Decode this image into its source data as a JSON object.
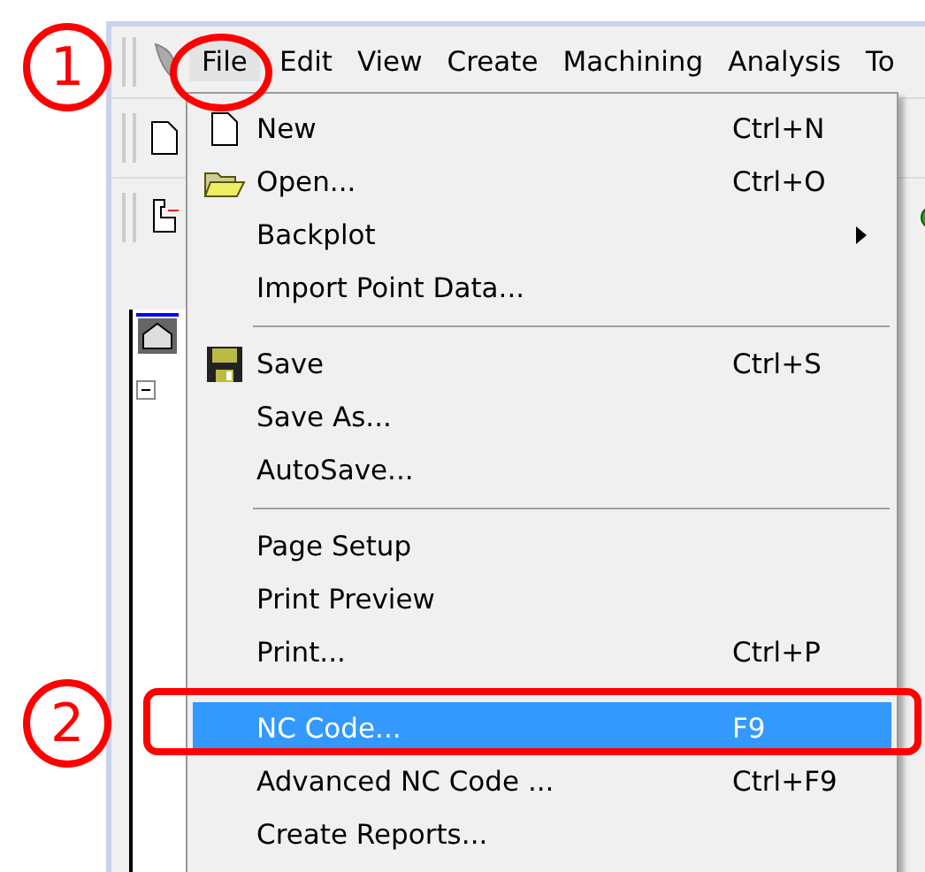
{
  "menu_bar": [
    {
      "label": "File",
      "selected": true
    },
    {
      "label": "Edit",
      "selected": false
    },
    {
      "label": "View",
      "selected": false
    },
    {
      "label": "Create",
      "selected": false
    },
    {
      "label": "Machining",
      "selected": false
    },
    {
      "label": "Analysis",
      "selected": false
    },
    {
      "label": "To",
      "selected": false
    }
  ],
  "file_menu": [
    {
      "kind": "item",
      "label": "New",
      "shortcut": "Ctrl+N",
      "submenu": false,
      "selected": false
    },
    {
      "kind": "item",
      "label": "Open...",
      "shortcut": "Ctrl+O",
      "submenu": false,
      "selected": false
    },
    {
      "kind": "item",
      "label": "Backplot",
      "submenu": true,
      "selected": false
    },
    {
      "kind": "item",
      "label": "Import Point Data...",
      "submenu": false,
      "selected": false
    },
    {
      "kind": "separator"
    },
    {
      "kind": "item",
      "label": "Save",
      "shortcut": "Ctrl+S",
      "submenu": false,
      "selected": false
    },
    {
      "kind": "item",
      "label": "Save As...",
      "submenu": false,
      "selected": false
    },
    {
      "kind": "item",
      "label": "AutoSave...",
      "submenu": false,
      "selected": false
    },
    {
      "kind": "separator"
    },
    {
      "kind": "item",
      "label": "Page Setup",
      "submenu": false,
      "selected": false
    },
    {
      "kind": "item",
      "label": "Print Preview",
      "submenu": false,
      "selected": false
    },
    {
      "kind": "item",
      "label": "Print...",
      "shortcut": "Ctrl+P",
      "submenu": false,
      "selected": false
    },
    {
      "kind": "separator"
    },
    {
      "kind": "item",
      "label": "NC Code...",
      "shortcut": "F9",
      "submenu": false,
      "selected": true
    },
    {
      "kind": "item",
      "label": "Advanced NC Code ...",
      "shortcut": "Ctrl+F9",
      "submenu": false,
      "selected": false
    },
    {
      "kind": "item",
      "label": "Create Reports...",
      "submenu": false,
      "selected": false
    }
  ],
  "callouts": [
    "1",
    "2"
  ]
}
